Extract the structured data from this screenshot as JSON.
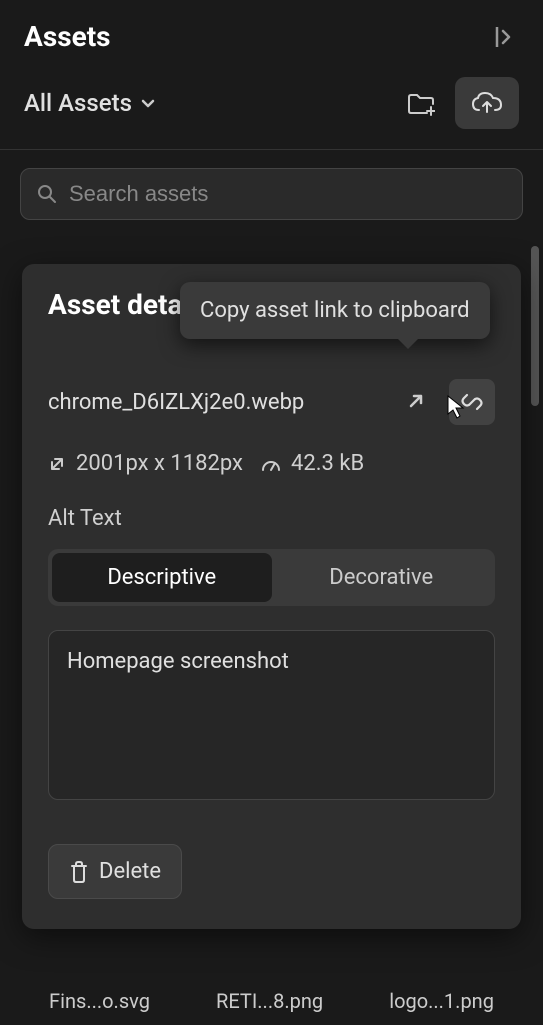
{
  "header": {
    "title": "Assets"
  },
  "subheader": {
    "folder_label": "All Assets"
  },
  "search": {
    "placeholder": "Search assets"
  },
  "tooltip": {
    "copy_link": "Copy asset link to clipboard"
  },
  "panel": {
    "title": "Asset details",
    "filename": "chrome_D6IZLXj2e0.webp",
    "dimensions": "2001px x 1182px",
    "filesize": "42.3 kB",
    "alt_label": "Alt Text",
    "tabs": {
      "descriptive": "Descriptive",
      "decorative": "Decorative"
    },
    "alt_text_value": "Homepage screenshot",
    "delete_label": "Delete"
  },
  "thumbnails": {
    "item1": "Fins...o.svg",
    "item2": "RETI...8.png",
    "item3": "logo...1.png"
  }
}
